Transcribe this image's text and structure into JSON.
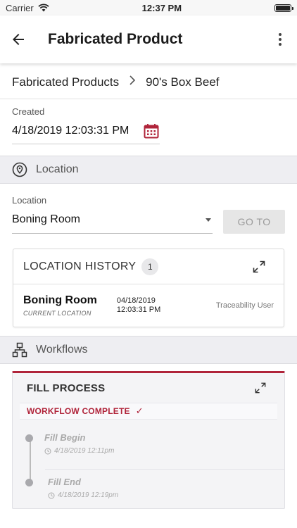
{
  "status_bar": {
    "carrier": "Carrier",
    "time": "12:37 PM"
  },
  "header": {
    "title": "Fabricated Product"
  },
  "breadcrumb": {
    "parent": "Fabricated Products",
    "current": "90's Box Beef"
  },
  "created": {
    "label": "Created",
    "value": "4/18/2019 12:03:31 PM"
  },
  "location_section": {
    "title": "Location"
  },
  "location_form": {
    "label": "Location",
    "selected": "Boning Room",
    "goto_label": "GO TO"
  },
  "location_history": {
    "title": "LOCATION HISTORY",
    "count": "1",
    "rows": [
      {
        "name": "Boning Room",
        "sub": "CURRENT LOCATION",
        "date": "04/18/2019",
        "time": "12:03:31 PM",
        "user": "Traceability User"
      }
    ]
  },
  "workflows_section": {
    "title": "Workflows"
  },
  "workflow": {
    "title": "FILL PROCESS",
    "status": "WORKFLOW COMPLETE",
    "status_mark": "✓",
    "steps": [
      {
        "name": "Fill Begin",
        "time": "4/18/2019 12:11pm"
      },
      {
        "name": "Fill End",
        "time": "4/18/2019 12:19pm"
      }
    ]
  },
  "colors": {
    "accent": "#b0243a",
    "section_bg": "#eeeef2"
  }
}
